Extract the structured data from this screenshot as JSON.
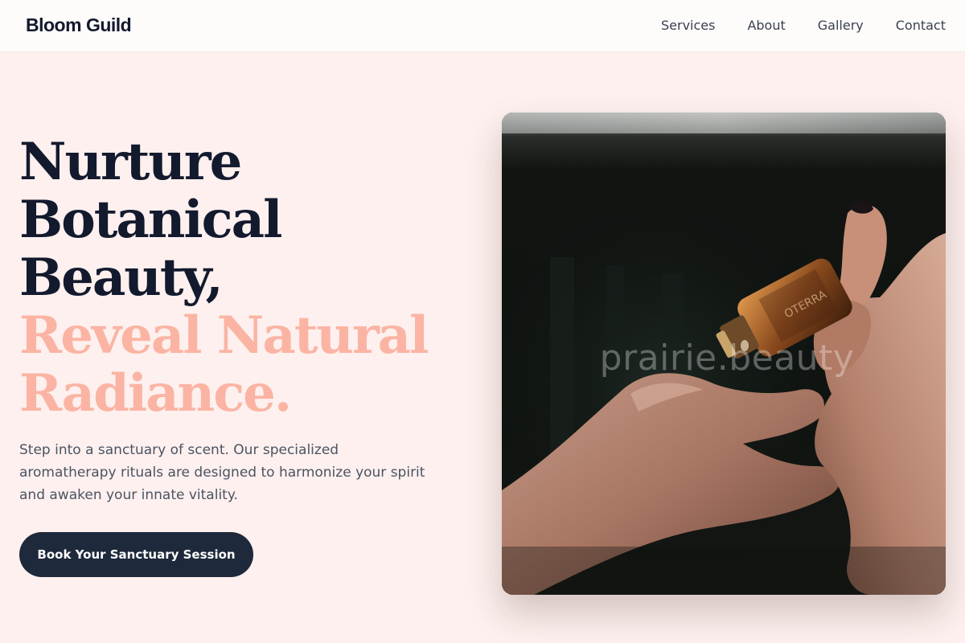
{
  "header": {
    "brand": "Bloom Guild",
    "nav": [
      "Services",
      "About",
      "Gallery",
      "Contact"
    ]
  },
  "hero": {
    "title_lines": [
      "Nurture",
      "Botanical",
      "Beauty,"
    ],
    "accent_lines": [
      "Reveal Natural",
      "Radiance."
    ],
    "subtitle": "Step into a sanctuary of scent. Our specialized aromatherapy rituals are designed to harmonize your spirit and awaken your innate vitality.",
    "cta_label": "Book Your Sanctuary Session"
  },
  "photo": {
    "watermark": "prairie.beauty",
    "bottle_label": "OTERRA"
  },
  "colors": {
    "background": "#fdf0ee",
    "title": "#131a2e",
    "accent": "#fbb4a3",
    "button": "#1e293b"
  }
}
